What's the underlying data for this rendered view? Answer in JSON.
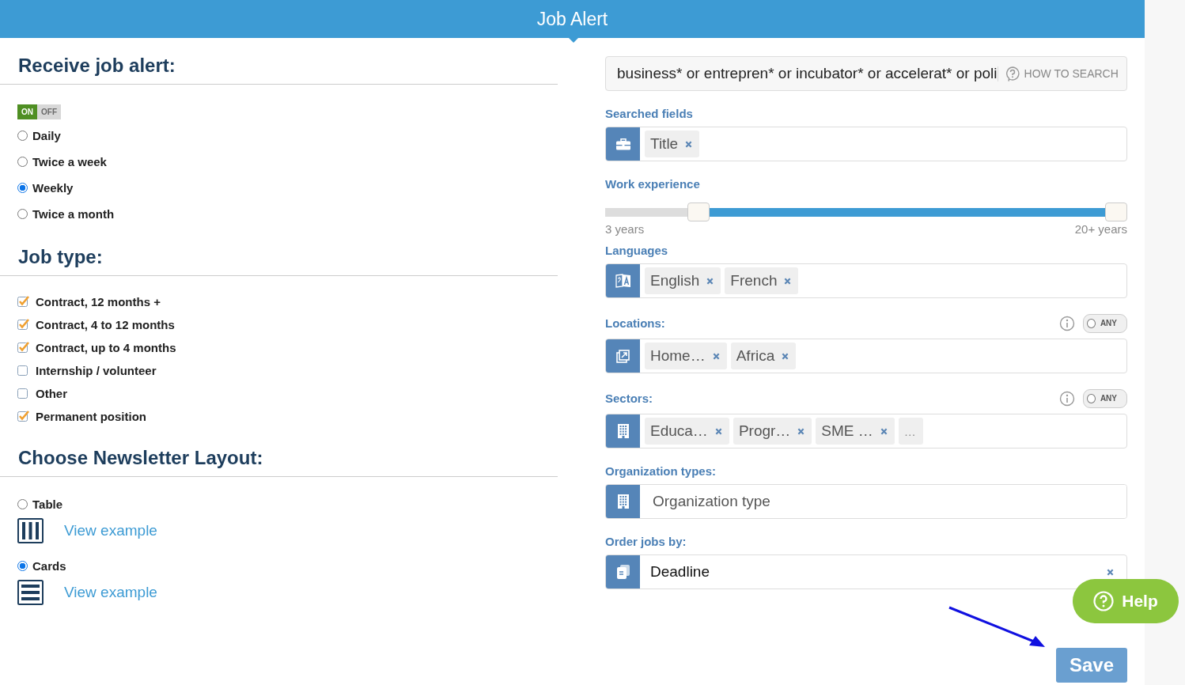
{
  "header": {
    "title": "Job Alert"
  },
  "alert": {
    "heading": "Receive job alert:",
    "toggle": {
      "on_label": "ON",
      "off_label": "OFF",
      "on": true
    },
    "frequencies": [
      {
        "label": "Daily",
        "selected": false
      },
      {
        "label": "Twice a week",
        "selected": false
      },
      {
        "label": "Weekly",
        "selected": true
      },
      {
        "label": "Twice a month",
        "selected": false
      }
    ]
  },
  "job_type": {
    "heading": "Job type:",
    "options": [
      {
        "label": "Contract, 12 months +",
        "checked": true
      },
      {
        "label": "Contract, 4 to 12 months",
        "checked": true
      },
      {
        "label": "Contract, up to 4 months",
        "checked": true
      },
      {
        "label": "Internship / volunteer",
        "checked": false
      },
      {
        "label": "Other",
        "checked": false
      },
      {
        "label": "Permanent position",
        "checked": true
      }
    ]
  },
  "layout": {
    "heading": "Choose Newsletter Layout:",
    "options": [
      {
        "label": "Table",
        "selected": false,
        "kind": "columns",
        "link": "View example"
      },
      {
        "label": "Cards",
        "selected": true,
        "kind": "rows",
        "link": "View example"
      }
    ]
  },
  "search": {
    "value": "business* or entrepren* or incubator* or accelerat* or poli",
    "help": "HOW TO SEARCH"
  },
  "searched_fields": {
    "label": "Searched fields",
    "tags": [
      {
        "label": "Title"
      }
    ]
  },
  "work_experience": {
    "label": "Work experience",
    "range_start": {
      "level": 0.165
    },
    "range_end": {
      "level": 1
    },
    "min_label": "3 years",
    "max_label": "20+ years"
  },
  "languages": {
    "label": "Languages",
    "tags": [
      {
        "label": "English"
      },
      {
        "label": "French"
      }
    ]
  },
  "locations": {
    "label": "Locations:",
    "any": {
      "label": "ANY",
      "on": false
    },
    "tags": [
      {
        "label": "Home…"
      },
      {
        "label": "Africa"
      }
    ]
  },
  "sectors": {
    "label": "Sectors:",
    "any": {
      "label": "ANY",
      "on": false
    },
    "tags": [
      {
        "label": "Educa…"
      },
      {
        "label": "Progr…"
      },
      {
        "label": "SME …"
      }
    ],
    "more": "…"
  },
  "organization_types": {
    "label": "Organization types:",
    "placeholder": "Organization type"
  },
  "order_by": {
    "label": "Order jobs by:",
    "value": "Deadline"
  },
  "help_button": {
    "label": "Help"
  },
  "save_button": {
    "label": "Save"
  }
}
